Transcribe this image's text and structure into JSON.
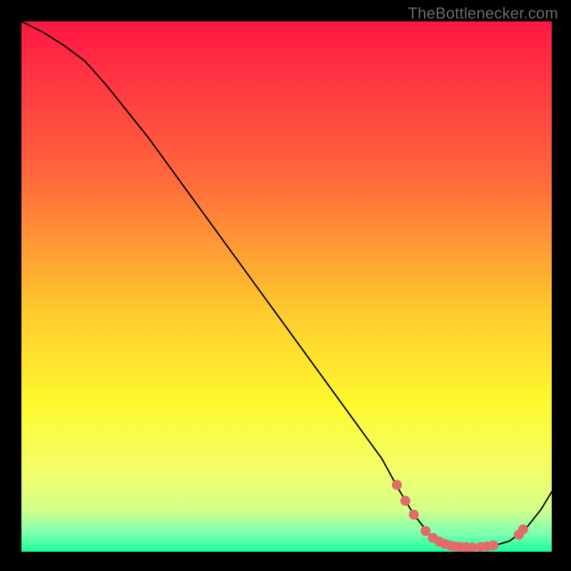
{
  "attribution": "TheBottlenecker.com",
  "chart_data": {
    "type": "line",
    "title": "",
    "xlabel": "",
    "ylabel": "",
    "xlim": [
      0,
      100
    ],
    "ylim": [
      0,
      100
    ],
    "background_gradient": {
      "type": "vertical",
      "stops": [
        {
          "pos": 0.0,
          "color": "#ff1744"
        },
        {
          "pos": 0.3,
          "color": "#ff6a3c"
        },
        {
          "pos": 0.55,
          "color": "#ffcb2e"
        },
        {
          "pos": 0.72,
          "color": "#fff92e"
        },
        {
          "pos": 0.85,
          "color": "#f3ff6a"
        },
        {
          "pos": 0.92,
          "color": "#d4ff8a"
        },
        {
          "pos": 0.965,
          "color": "#7dffb0"
        },
        {
          "pos": 1.0,
          "color": "#1aff9c"
        }
      ]
    },
    "series": [
      {
        "name": "bottleneck-curve",
        "color": "#000000",
        "stroke_width": 2,
        "x": [
          0,
          4,
          8,
          12,
          16,
          20,
          24,
          28,
          32,
          36,
          40,
          44,
          48,
          52,
          56,
          60,
          64,
          68,
          71,
          74,
          77,
          80,
          83,
          86,
          89,
          92,
          95,
          98,
          100
        ],
        "y": [
          100,
          98,
          95.5,
          92.5,
          88,
          83,
          78,
          72.5,
          67,
          61.5,
          56,
          50.5,
          45,
          39.5,
          34,
          28.5,
          23,
          17.5,
          12,
          7,
          3.2,
          1.4,
          0.8,
          0.8,
          1.1,
          2.0,
          4.2,
          8.0,
          11.3
        ]
      }
    ],
    "markers": {
      "name": "sweet-spot-points",
      "color": "#e46a6a",
      "radius": 7,
      "x": [
        70.8,
        72.4,
        74.0,
        76.2,
        77.6,
        78.8,
        79.8,
        80.8,
        81.8,
        82.8,
        83.8,
        85.0,
        86.6,
        87.8,
        89.0,
        93.8,
        94.6
      ],
      "y": [
        12.6,
        9.6,
        7.0,
        3.9,
        2.6,
        1.9,
        1.5,
        1.2,
        1.0,
        0.9,
        0.9,
        0.8,
        0.9,
        1.0,
        1.2,
        3.2,
        4.2
      ]
    }
  }
}
